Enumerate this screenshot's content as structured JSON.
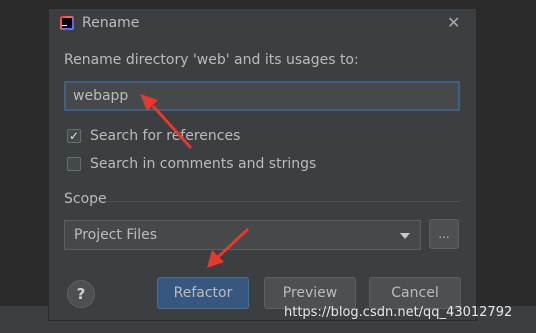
{
  "dialog": {
    "title": "Rename",
    "app_icon": "jetbrains-app-icon",
    "prompt": "Rename directory 'web' and its usages to:",
    "new_name_value": "webapp",
    "options": [
      {
        "label": "Search for references",
        "checked": true
      },
      {
        "label": "Search in comments and strings",
        "checked": false
      }
    ],
    "scope": {
      "label": "Scope",
      "selected": "Project Files",
      "browse_label": "..."
    },
    "help_label": "?",
    "buttons": {
      "refactor": "Refactor",
      "preview": "Preview",
      "cancel": "Cancel"
    }
  },
  "annotation": {
    "color": "#e8372b"
  },
  "watermark": "https://blog.csdn.net/qq_43012792"
}
